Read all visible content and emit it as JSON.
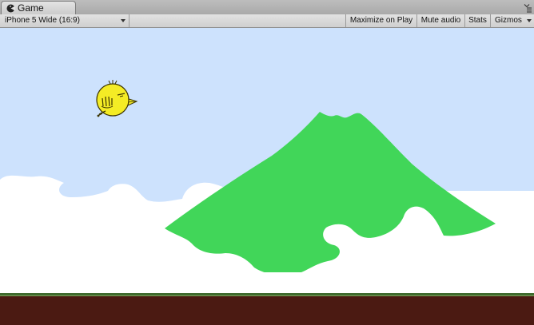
{
  "tab": {
    "title": "Game",
    "icon": "pacman-icon"
  },
  "toolbar": {
    "aspect_ratio": "iPhone 5 Wide (16:9)",
    "maximize_on_play": "Maximize on Play",
    "mute_audio": "Mute audio",
    "stats": "Stats",
    "gizmos": "Gizmos"
  },
  "colors": {
    "sky": "#cde2fd",
    "clouds": "#ffffff",
    "mountain": "#41d659",
    "ground": "#4b1a12",
    "grass_line": "#3f6b2e",
    "bird_body": "#f4ec25",
    "bird_outline": "#3a3300"
  }
}
